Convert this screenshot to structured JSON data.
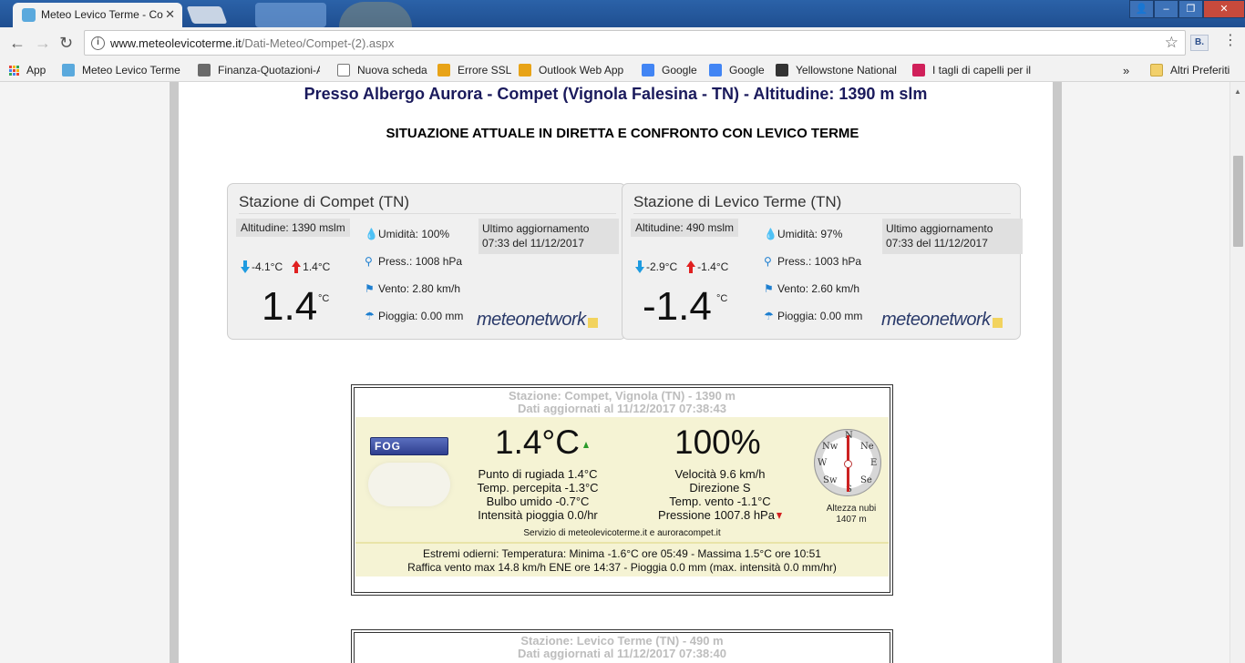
{
  "browser": {
    "tab_title": "Meteo Levico Terme - Co",
    "tab_close": "✕",
    "url_host": "www.meteolevicoterme.it",
    "url_path": "/Dati-Meteo/Compet-(2).aspx",
    "ext_label": "B.",
    "window_controls": {
      "user": "👤",
      "minimize": "–",
      "maximize": "❐",
      "close": "✕"
    }
  },
  "bookmarks": {
    "apps": "App",
    "items": [
      {
        "label": "Meteo Levico Terme",
        "icon": "cloud-icon",
        "color": "#5aa9dd"
      },
      {
        "label": "Finanza-Quotazioni-A",
        "icon": "chart-icon",
        "color": "#6a6a6a"
      },
      {
        "label": "Nuova scheda",
        "icon": "page-icon",
        "color": "#ffffff"
      },
      {
        "label": "Errore SSL",
        "icon": "outlook-icon",
        "color": "#e8a317"
      },
      {
        "label": "Outlook Web App",
        "icon": "outlook-icon",
        "color": "#e8a317"
      },
      {
        "label": "Google",
        "icon": "google-icon",
        "color": "#4285f4"
      },
      {
        "label": "Google",
        "icon": "google-icon",
        "color": "#4285f4"
      },
      {
        "label": "Yellowstone National",
        "icon": "flag-icon",
        "color": "#333333"
      },
      {
        "label": "I tagli di capelli per il",
        "icon": "pin-icon",
        "color": "#d0205a"
      }
    ],
    "overflow": "»",
    "other": "Altri Preferiti"
  },
  "page": {
    "title": "Presso Albergo Aurora - Compet (Vignola Falesina - TN) - Altitudine: 1390 m slm",
    "subtitle": "SITUAZIONE ATTUALE IN DIRETTA E CONFRONTO CON LEVICO TERME"
  },
  "widgets": [
    {
      "title": "Stazione di Compet (TN)",
      "altitude": "Altitudine: 1390 mslm",
      "updated_line1": "Ultimo aggiornamento",
      "updated_line2": "07:33 del 11/12/2017",
      "min": "-4.1°C",
      "max": "1.4°C",
      "temp": "1.4",
      "unit": "°C",
      "humidity": "Umidità: 100%",
      "pressure": "Press.: 1008 hPa",
      "wind": "Vento: 2.80 km/h",
      "rain": "Pioggia: 0.00 mm",
      "brand": "meteonetwork"
    },
    {
      "title": "Stazione di Levico Terme (TN)",
      "altitude": "Altitudine: 490 mslm",
      "updated_line1": "Ultimo aggiornamento",
      "updated_line2": "07:33 del 11/12/2017",
      "min": "-2.9°C",
      "max": "-1.4°C",
      "temp": "-1.4",
      "unit": "°C",
      "humidity": "Umidità: 97%",
      "pressure": "Press.: 1003 hPa",
      "wind": "Vento: 2.60 km/h",
      "rain": "Pioggia: 0.00 mm",
      "brand": "meteonetwork"
    }
  ],
  "box1": {
    "station": "Stazione: Compet, Vignola (TN) - 1390 m",
    "updated": "Dati aggiornati al 11/12/2017 07:38:43",
    "condition": "FOG",
    "temp": "1.4°C",
    "humidity": "100%",
    "left_list": [
      "Punto di rugiada 1.4°C",
      "Temp. percepita -1.3°C",
      "Bulbo umido -0.7°C",
      "Intensità pioggia 0.0/hr"
    ],
    "right_list": [
      "Velocità 9.6 km/h",
      "Direzione S",
      "Temp. vento -1.1°C",
      "Pressione 1007.8 hPa"
    ],
    "service": "Servizio di meteolevicoterme.it e auroracompet.it",
    "cloud_height_label": "Altezza nubi",
    "cloud_height": "1407 m",
    "compass": {
      "n": "N",
      "ne": "Ne",
      "e": "E",
      "se": "Se",
      "s": "S",
      "sw": "Sw",
      "w": "W",
      "nw": "Nw"
    },
    "extremes_line1": "Estremi odierni: Temperatura: Minima -1.6°C ore 05:49 - Massima 1.5°C ore 10:51",
    "extremes_line2": "Raffica vento max 14.8 km/h ENE ore 14:37 - Pioggia 0.0 mm (max. intensità 0.0 mm/hr)"
  },
  "box2": {
    "station": "Stazione: Levico Terme (TN) - 490 m",
    "updated": "Dati aggiornati al 11/12/2017 07:38:40"
  }
}
